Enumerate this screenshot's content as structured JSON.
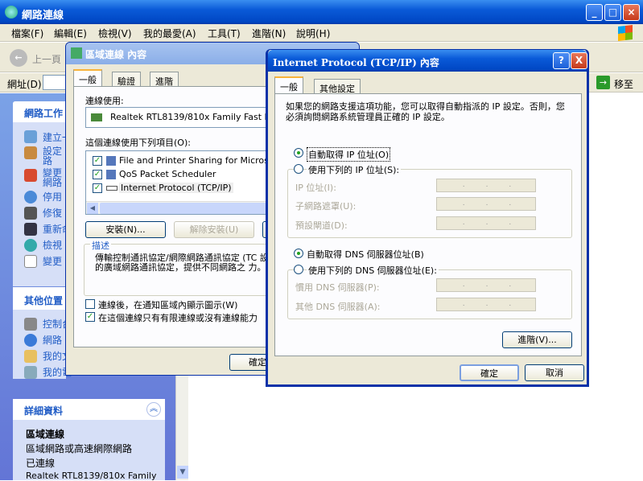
{
  "main_window": {
    "title": "網路連線",
    "menu": [
      "檔案(F)",
      "編輯(E)",
      "檢視(V)",
      "我的最愛(A)",
      "工具(T)",
      "進階(N)",
      "說明(H)"
    ],
    "back_label": "上一頁",
    "address_label": "網址(D)",
    "go_label": "移至"
  },
  "left_panel": {
    "network_tasks_title": "網路工作",
    "network_tasks": [
      "建立一",
      "設定路",
      "變更網路設定",
      "停用",
      "修復",
      "重新命",
      "檢視",
      "變更"
    ],
    "other_places_title": "其他位置",
    "other_places": [
      "控制台",
      "網路",
      "我的文",
      "我的電"
    ],
    "details_title": "詳細資料",
    "details_name": "區域連線",
    "details_type": "區域網路或高速網際網路",
    "details_status": "已連線",
    "details_adapter": "Realtek RTL8139/810x Family"
  },
  "lan_dialog": {
    "title": "區域連線 內容",
    "tabs": [
      "一般",
      "驗證",
      "進階"
    ],
    "connect_using_label": "連線使用:",
    "adapter_name": "Realtek RTL8139/810x Family Fast E",
    "items_label": "這個連線使用下列項目(O):",
    "items": [
      "File and Printer Sharing for Microsoft N",
      "QoS Packet Scheduler",
      "Internet Protocol (TCP/IP)"
    ],
    "install_label": "安裝(N)...",
    "uninstall_label": "解除安裝(U)",
    "description_title": "描述",
    "description_text": "傳輸控制通訊協定/網際網路通訊協定 (TC 設的廣域網路通訊協定，提供不同網路之 力。",
    "show_icon_label": "連線後，在通知區域內顯示圖示(W)",
    "notify_label": "在這個連線只有有限連線或沒有連線能力",
    "ok_label": "確定"
  },
  "tcpip_dialog": {
    "title": "Internet Protocol (TCP/IP) 內容",
    "tabs": [
      "一般",
      "其他設定"
    ],
    "intro": "如果您的網路支援這項功能，您可以取得自動指派的 IP 設定。否則，您必須詢問網路系統管理員正確的 IP 設定。",
    "auto_ip_label": "自動取得 IP 位址(O)",
    "manual_ip_label": "使用下列的 IP 位址(S):",
    "ip_address_label": "IP 位址(I):",
    "subnet_label": "子網路遮罩(U):",
    "gateway_label": "預設閘道(D):",
    "auto_dns_label": "自動取得 DNS 伺服器位址(B)",
    "manual_dns_label": "使用下列的 DNS 伺服器位址(E):",
    "preferred_dns_label": "慣用 DNS 伺服器(P):",
    "alternate_dns_label": "其他 DNS 伺服器(A):",
    "field_dots": "...",
    "advanced_label": "進階(V)...",
    "ok_label": "確定",
    "cancel_label": "取消",
    "help_label": "?",
    "close_label": "X"
  }
}
